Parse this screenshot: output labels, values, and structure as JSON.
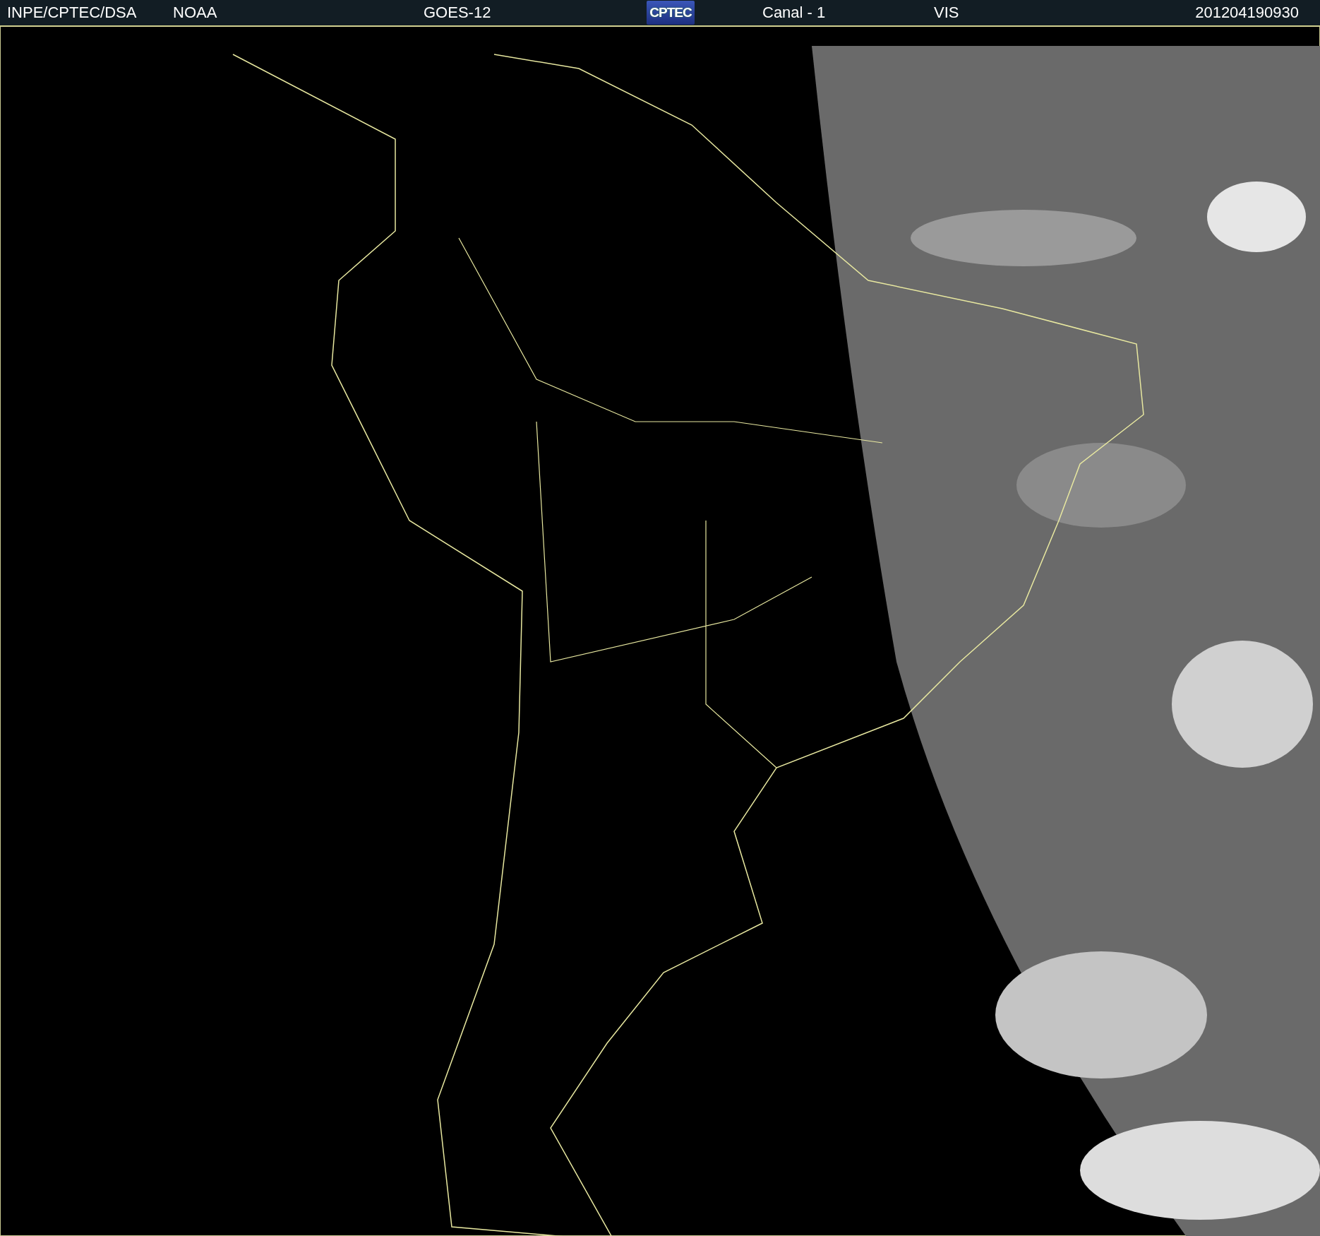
{
  "header": {
    "items": [
      {
        "kind": "text",
        "label": "INPE/CPTEC/DSA"
      },
      {
        "kind": "text",
        "label": "NOAA"
      },
      {
        "kind": "text",
        "label": "GOES-12"
      },
      {
        "kind": "logo",
        "label": "CPTEC"
      },
      {
        "kind": "text",
        "label": "Canal - 1"
      },
      {
        "kind": "text",
        "label": "VIS"
      },
      {
        "kind": "text",
        "label": "201204190930"
      }
    ]
  }
}
